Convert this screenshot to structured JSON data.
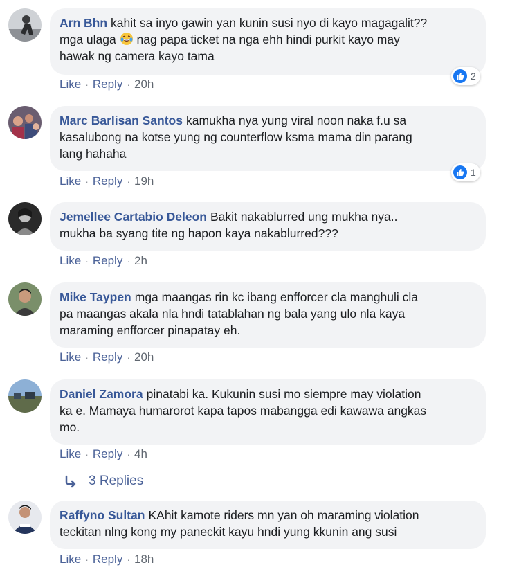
{
  "colors": {
    "author": "#385898",
    "link": "#4b6298",
    "bubble": "#f2f3f5",
    "like_blue": "#1877f2"
  },
  "comments": [
    {
      "author": "Arn Bhn",
      "text_line1": "kahit sa inyo gawin yan kunin susi nyo di kayo magagalit??",
      "text_line2a": "mga ulaga",
      "emoji": "laughing-crying-emoji",
      "text_line2b": "nag papa ticket na nga ehh hindi purkit kayo may",
      "text_line3": "hawak ng camera kayo tama",
      "like": "Like",
      "reply": "Reply",
      "time": "20h",
      "reactions": "2"
    },
    {
      "author": "Marc Barlisan Santos",
      "text_line1": "kamukha nya yung viral noon naka f.u sa",
      "text_line2": "kasalubong na kotse yung ng counterflow ksma mama din parang",
      "text_line3": "lang hahaha",
      "like": "Like",
      "reply": "Reply",
      "time": "19h",
      "reactions": "1"
    },
    {
      "author": "Jemellee Cartabio Deleon",
      "text_line1": "Bakit nakablurred ung mukha nya..",
      "text_line2": "mukha ba syang tite ng hapon kaya nakablurred???",
      "like": "Like",
      "reply": "Reply",
      "time": "2h"
    },
    {
      "author": "Mike Taypen",
      "text_line1": "mga maangas rin kc ibang enfforcer cla manghuli cla",
      "text_line2": "pa maangas akala nla hndi tatablahan ng bala yang ulo nla kaya",
      "text_line3": "maraming enfforcer pinapatay eh.",
      "like": "Like",
      "reply": "Reply",
      "time": "20h"
    },
    {
      "author": "Daniel Zamora",
      "text_line1": "pinatabi ka. Kukunin susi mo siempre may violation",
      "text_line2": "ka e. Mamaya humarorot kapa tapos mabangga edi kawawa angkas",
      "text_line3": "mo.",
      "like": "Like",
      "reply": "Reply",
      "time": "4h"
    },
    {
      "author": "Raffyno Sultan",
      "text_line1": "KAhit kamote riders mn yan oh maraming violation",
      "text_line2": "teckitan nlng kong my paneckit kayu hndi yung kkunin ang susi",
      "like": "Like",
      "reply": "Reply",
      "time": "18h"
    }
  ],
  "replies_link": "3 Replies"
}
